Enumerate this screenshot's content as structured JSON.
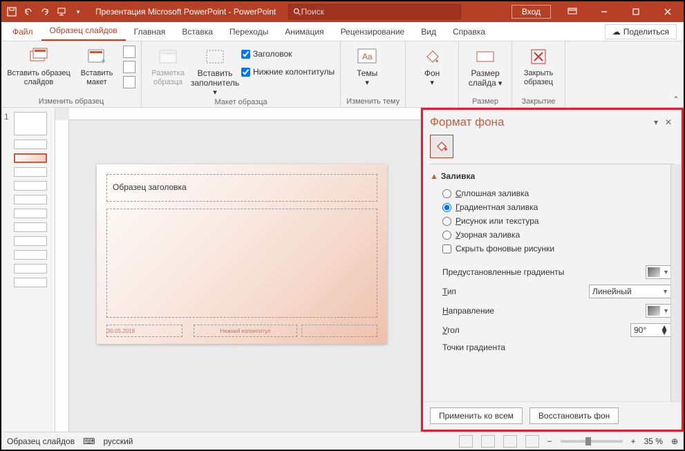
{
  "titlebar": {
    "title": "Презентация Microsoft PowerPoint - PowerPoint",
    "search_placeholder": "Поиск",
    "signin": "Вход"
  },
  "tabs": {
    "file": "Файл",
    "slidemaster": "Образец слайдов",
    "home": "Главная",
    "insert": "Вставка",
    "transitions": "Переходы",
    "animations": "Анимация",
    "review": "Рецензирование",
    "view": "Вид",
    "help": "Справка",
    "share": "Поделиться"
  },
  "ribbon": {
    "g1": {
      "insert_master": "Вставить образец слайдов",
      "insert_layout": "Вставить макет",
      "label": "Изменить образец"
    },
    "g2": {
      "master_layout": "Разметка образца",
      "insert_ph": "Вставить заполнитель",
      "chk_title": "Заголовок",
      "chk_footers": "Нижние колонтитулы",
      "label": "Макет образца"
    },
    "g3": {
      "themes": "Темы",
      "label": "Изменить тему"
    },
    "g4": {
      "bg": "Фон",
      "label": ""
    },
    "g5": {
      "size": "Размер слайда",
      "label": "Размер"
    },
    "g6": {
      "close": "Закрыть образец",
      "label": "Закрытие"
    }
  },
  "thumbs": {
    "num": "1"
  },
  "slide": {
    "title_ph": "Образец заголовка",
    "footer_date": "30.05.2018",
    "footer_center": "Нижний колонтитул"
  },
  "pane": {
    "title": "Формат фона",
    "section": "Заливка",
    "opt_solid": "Сплошная заливка",
    "opt_gradient": "Градиентная заливка",
    "opt_picture": "Рисунок или текстура",
    "opt_pattern": "Узорная заливка",
    "chk_hidebg": "Скрыть фоновые рисунки",
    "preset": "Предустановленные градиенты",
    "type": "Тип",
    "type_val": "Линейный",
    "direction": "Направление",
    "angle": "Угол",
    "angle_val": "90°",
    "stops": "Точки градиента",
    "apply_all": "Применить ко всем",
    "reset": "Восстановить фон"
  },
  "status": {
    "mode": "Образец слайдов",
    "lang": "русский",
    "zoom": "35 %"
  }
}
